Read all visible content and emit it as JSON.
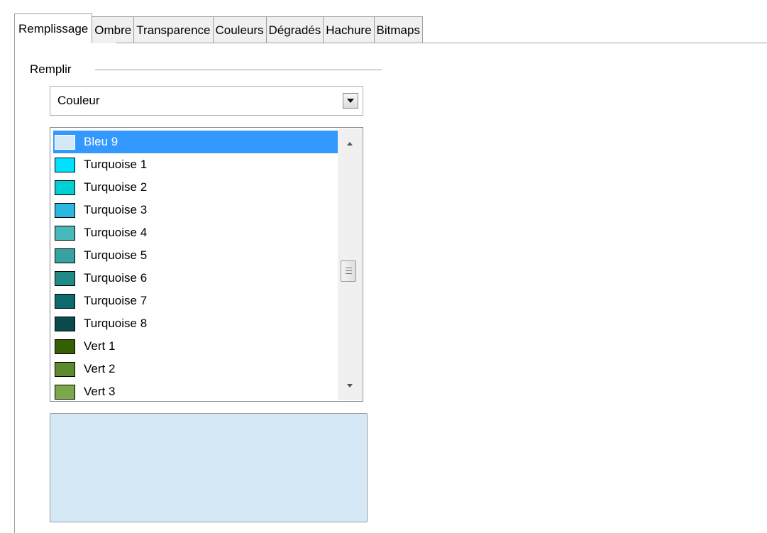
{
  "tabs": [
    {
      "label": "Remplissage",
      "active": true
    },
    {
      "label": "Ombre",
      "active": false
    },
    {
      "label": "Transparence",
      "active": false
    },
    {
      "label": "Couleurs",
      "active": false
    },
    {
      "label": "Dégradés",
      "active": false
    },
    {
      "label": "Hachure",
      "active": false
    },
    {
      "label": "Bitmaps",
      "active": false
    }
  ],
  "fill_group": {
    "label": "Remplir",
    "type_select": {
      "value": "Couleur",
      "icon": "chevron-down-icon"
    },
    "color_list": {
      "selected": "Bleu 9",
      "items": [
        {
          "name": "Bleu 9",
          "color": "#d4e8f6"
        },
        {
          "name": "Turquoise 1",
          "color": "#00e0ff"
        },
        {
          "name": "Turquoise 2",
          "color": "#00cfd6"
        },
        {
          "name": "Turquoise 3",
          "color": "#2bb8e0"
        },
        {
          "name": "Turquoise 4",
          "color": "#48b8b8"
        },
        {
          "name": "Turquoise 5",
          "color": "#36a2a2"
        },
        {
          "name": "Turquoise 6",
          "color": "#1f8a86"
        },
        {
          "name": "Turquoise 7",
          "color": "#0d6a6a"
        },
        {
          "name": "Turquoise 8",
          "color": "#0a4a4a"
        },
        {
          "name": "Vert 1",
          "color": "#355e05"
        },
        {
          "name": "Vert 2",
          "color": "#5c8a2c"
        },
        {
          "name": "Vert 3",
          "color": "#7da84a"
        }
      ]
    },
    "preview_color": "#d4e8f6"
  }
}
